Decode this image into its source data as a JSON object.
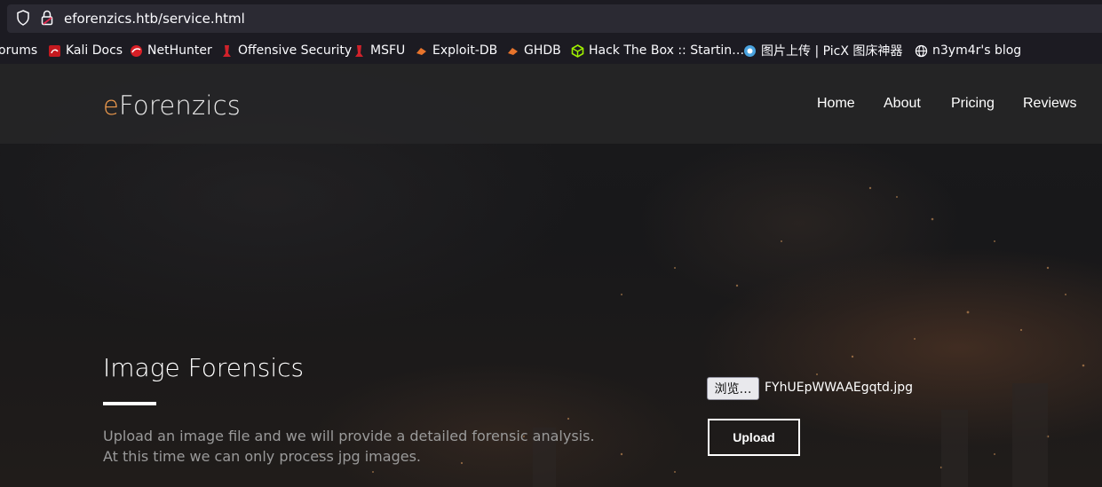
{
  "browser": {
    "url": "eforenzics.htb/service.html",
    "bookmarks": [
      {
        "label": "orums",
        "icon": "forums-icon"
      },
      {
        "label": "Kali Docs",
        "icon": "kali-docs-icon"
      },
      {
        "label": "NetHunter",
        "icon": "nethunter-icon"
      },
      {
        "label": "Offensive Security",
        "icon": "offensive-security-icon"
      },
      {
        "label": "MSFU",
        "icon": "msfu-icon"
      },
      {
        "label": "Exploit-DB",
        "icon": "exploit-db-icon"
      },
      {
        "label": "GHDB",
        "icon": "ghdb-icon"
      },
      {
        "label": "Hack The Box :: Startin…",
        "icon": "hackthebox-icon"
      },
      {
        "label": "图片上传 | PicX 图床神器",
        "icon": "picx-icon"
      },
      {
        "label": "n3ym4r's blog",
        "icon": "globe-icon"
      }
    ]
  },
  "site": {
    "brand_e": "e",
    "brand_rest": "Forenzics",
    "nav": [
      "Home",
      "About",
      "Pricing",
      "Reviews"
    ]
  },
  "main": {
    "title": "Image Forensics",
    "desc_line1": "Upload an image file and we will provide a detailed forensic analysis.",
    "desc_line2": "At this time we can only process jpg images."
  },
  "form": {
    "browse_label": "浏览…",
    "file_name": "FYhUEpWWAAEgqtd.jpg",
    "upload_label": "Upload"
  },
  "colors": {
    "accent": "#ee9a4d",
    "chrome_bg": "#1c1b22",
    "urlfield_bg": "#2b2a33"
  }
}
